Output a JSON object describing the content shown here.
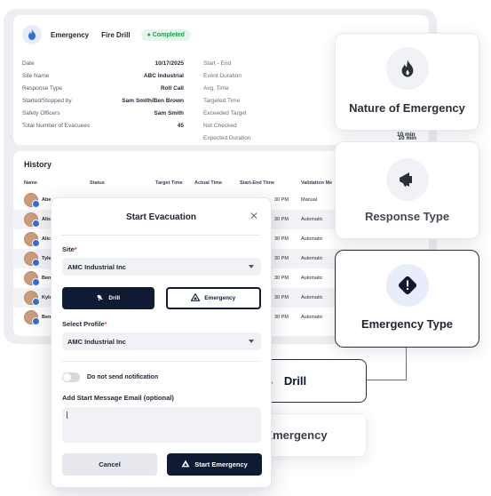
{
  "event": {
    "title": "Emergency",
    "type": "Fire Drill",
    "status": "Completed",
    "details_left": [
      {
        "label": "Date",
        "value": "10/17/2025"
      },
      {
        "label": "Site Name",
        "value": "ABC Industrial"
      },
      {
        "label": "Response Type",
        "value": "Roll Call"
      },
      {
        "label": "Started/Stopped by",
        "value": "Sam Smith/Ben Brown"
      },
      {
        "label": "Safety Officers",
        "value": "Sam Smith"
      },
      {
        "label": "Total Number of Evacuees",
        "value": "45"
      }
    ],
    "details_right": [
      {
        "label": "Start - End",
        "value": ""
      },
      {
        "label": "Event Duration",
        "value": ""
      },
      {
        "label": "Avg. Time",
        "value": ""
      },
      {
        "label": "Targeted Time",
        "value": ""
      },
      {
        "label": "Exceeded Target",
        "value": ""
      },
      {
        "label": "Not Checked",
        "value": ""
      },
      {
        "label": "Expected Duration",
        "value": "10 min"
      }
    ]
  },
  "history": {
    "title": "History",
    "columns": [
      "Name",
      "Status",
      "Target Time",
      "Actual Time",
      "Start-End Time",
      "Validation Me"
    ],
    "rows": [
      {
        "name": "Abe",
        "time": "30 PM",
        "method": "Manual"
      },
      {
        "name": "Alis",
        "time": "30 PM",
        "method": "Automatic"
      },
      {
        "name": "Alic",
        "time": "30 PM",
        "method": "Automatic"
      },
      {
        "name": "Tyle",
        "time": "30 PM",
        "method": "Automatic"
      },
      {
        "name": "Ben",
        "time": "30 PM",
        "method": "Automatic"
      },
      {
        "name": "Kyle",
        "time": "30 PM",
        "method": "Automatic"
      },
      {
        "name": "Ben",
        "time": "30 PM",
        "method": "Automatic"
      }
    ]
  },
  "modal": {
    "title": "Start Evacuation",
    "site_label": "Site",
    "site_value": "AMC Industrial Inc",
    "seg_drill": "Drill",
    "seg_emergency": "Emergency",
    "profile_label": "Select Profile",
    "profile_value": "AMC Industrial Inc",
    "notify_label": "Do not send notification",
    "email_label": "Add Start Message Email (optional)",
    "cancel_label": "Cancel",
    "start_label": "Start Emergency"
  },
  "cards": {
    "nature": "Nature of Emergency",
    "response": "Response Type",
    "etype": "Emergency Type"
  },
  "options": {
    "drill": "Drill",
    "emergency": "Emergency"
  },
  "colors": {
    "navy": "#0f1a33",
    "accent_blue": "#2f6fde",
    "success_green": "#1d9a4e"
  }
}
